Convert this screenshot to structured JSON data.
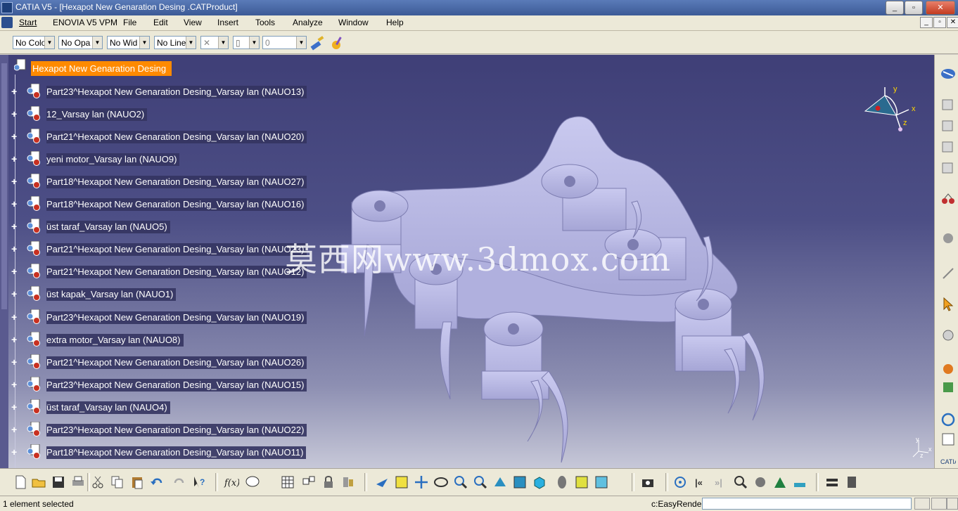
{
  "window": {
    "title": "CATIA V5 - [Hexapot New Genaration Desing  .CATProduct]",
    "buttons": {
      "minimize": "_",
      "restore": "▫",
      "close": "✕"
    }
  },
  "menu": {
    "items": [
      "Start",
      "ENOVIA V5 VPM",
      "File",
      "Edit",
      "View",
      "Insert",
      "Tools",
      "Analyze",
      "Window",
      "Help"
    ],
    "doc_buttons": [
      "_",
      "▫",
      "✕"
    ]
  },
  "properties": {
    "color": "No Colo",
    "opacity": "No Opa",
    "line_width": "No Wid",
    "line_type": "No Line",
    "point_symbol": "✕",
    "layer": "",
    "layer_value": "0"
  },
  "tree": {
    "root": "Hexapot New Genaration Desing",
    "items": [
      {
        "label": "Part23^Hexapot New Genaration Desing_Varsay  lan (NAUO13)"
      },
      {
        "label": "12_Varsay  lan (NAUO2)"
      },
      {
        "label": "Part21^Hexapot New Genaration Desing_Varsay  lan (NAUO20)"
      },
      {
        "label": "yeni motor_Varsay  lan (NAUO9)"
      },
      {
        "label": "Part18^Hexapot New Genaration Desing_Varsay  lan (NAUO27)"
      },
      {
        "label": "Part18^Hexapot New Genaration Desing_Varsay  lan (NAUO16)"
      },
      {
        "label": "üst taraf_Varsay  lan (NAUO5)"
      },
      {
        "label": "Part21^Hexapot New Genaration Desing_Varsay  lan (NAUO23)"
      },
      {
        "label": "Part21^Hexapot New Genaration Desing_Varsay  lan (NAUO12)"
      },
      {
        "label": "üst kapak_Varsay  lan (NAUO1)"
      },
      {
        "label": "Part23^Hexapot New Genaration Desing_Varsay  lan (NAUO19)"
      },
      {
        "label": "extra motor_Varsay  lan (NAUO8)"
      },
      {
        "label": "Part21^Hexapot New Genaration Desing_Varsay  lan (NAUO26)"
      },
      {
        "label": "Part23^Hexapot New Genaration Desing_Varsay  lan (NAUO15)"
      },
      {
        "label": "üst taraf_Varsay  lan (NAUO4)"
      },
      {
        "label": "Part23^Hexapot New Genaration Desing_Varsay  lan (NAUO22)"
      },
      {
        "label": "Part18^Hexapot New Genaration Desing_Varsay  lan (NAUO11)"
      }
    ]
  },
  "viewport": {
    "watermark": "莫西网www.3dmox.com",
    "compass_axes": {
      "x": "x",
      "y": "y",
      "z": "z"
    },
    "axis_labels": {
      "x": "x",
      "y": "y",
      "z": "z"
    },
    "background_top": "#3f3f77",
    "background_bottom": "#c7c8d8",
    "model_color": "#b9b9e6"
  },
  "status": {
    "message": "1 element selected",
    "command_label": "c:EasyRende",
    "command_value": ""
  },
  "colors": {
    "selection": "#ff8a00",
    "toolbar_bg": "#ece9d8"
  }
}
